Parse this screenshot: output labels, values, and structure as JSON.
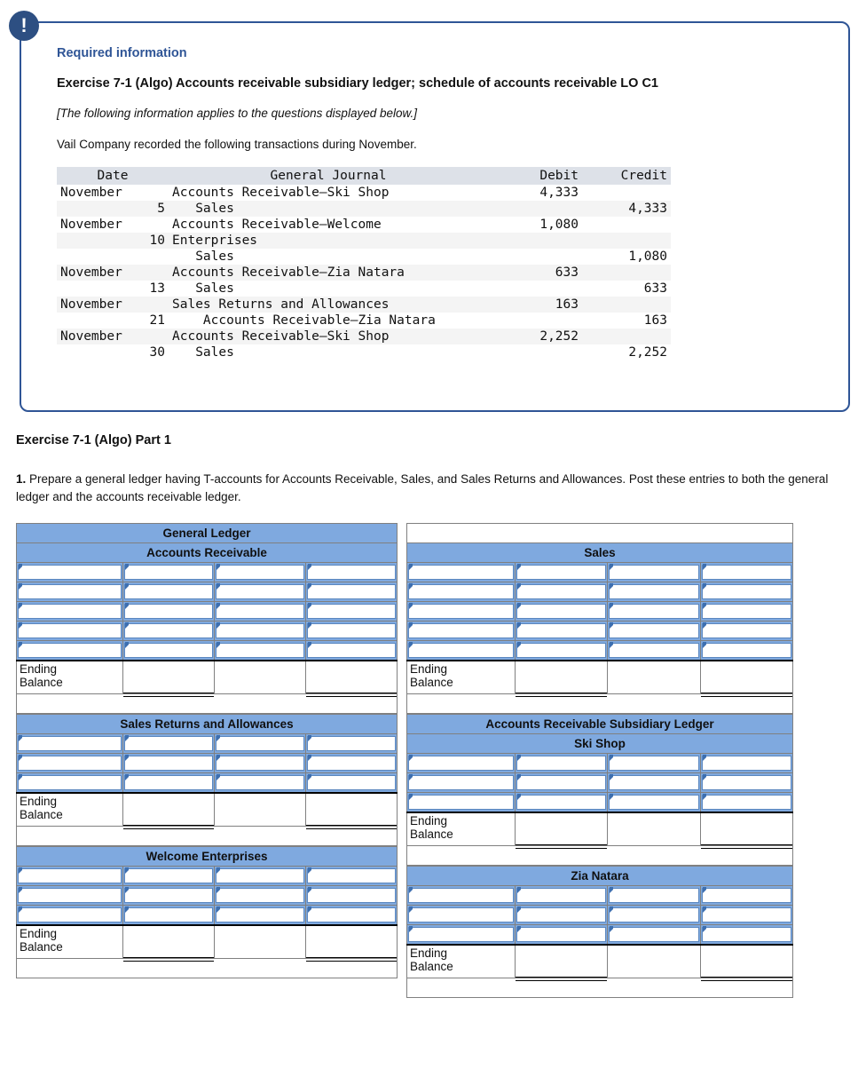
{
  "alert": {
    "icon": "exclamation-icon",
    "required_label": "Required information",
    "exercise_title": "Exercise 7-1 (Algo) Accounts receivable subsidiary ledger; schedule of accounts receivable LO C1",
    "note": "[The following information applies to the questions displayed below.]",
    "intro": "Vail Company recorded the following transactions during November."
  },
  "journal": {
    "headers": {
      "date": "Date",
      "account": "General Journal",
      "debit": "Debit",
      "credit": "Credit"
    },
    "rows": [
      {
        "month": "November",
        "day": "",
        "account": "Accounts Receivable—Ski Shop",
        "debit": "4,333",
        "credit": ""
      },
      {
        "month": "",
        "day": "5",
        "account": "   Sales",
        "debit": "",
        "credit": "4,333"
      },
      {
        "month": "November",
        "day": "",
        "account": "Accounts Receivable—Welcome",
        "debit": "1,080",
        "credit": ""
      },
      {
        "month": "",
        "day": "10",
        "account": "Enterprises",
        "debit": "",
        "credit": ""
      },
      {
        "month": "",
        "day": "",
        "account": "   Sales",
        "debit": "",
        "credit": "1,080"
      },
      {
        "month": "November",
        "day": "",
        "account": "Accounts Receivable—Zia Natara",
        "debit": "633",
        "credit": ""
      },
      {
        "month": "",
        "day": "13",
        "account": "   Sales",
        "debit": "",
        "credit": "633"
      },
      {
        "month": "November",
        "day": "",
        "account": "Sales Returns and Allowances",
        "debit": "163",
        "credit": ""
      },
      {
        "month": "",
        "day": "21",
        "account": "    Accounts Receivable—Zia Natara",
        "debit": "",
        "credit": "163"
      },
      {
        "month": "November",
        "day": "",
        "account": "Accounts Receivable—Ski Shop",
        "debit": "2,252",
        "credit": ""
      },
      {
        "month": "",
        "day": "30",
        "account": "   Sales",
        "debit": "",
        "credit": "2,252"
      }
    ]
  },
  "part": {
    "heading": "Exercise 7-1 (Algo) Part 1",
    "question_number": "1.",
    "question_text": " Prepare a general ledger having T-accounts for Accounts Receivable, Sales, and Sales Returns and Allowances. Post these entries to both the general ledger and the accounts receivable ledger."
  },
  "ledgers": {
    "general_ledger_label": "General Ledger",
    "subsidiary_ledger_label": "Accounts Receivable Subsidiary Ledger",
    "ending_balance_label": "Ending\nBalance",
    "ending_balance_line1": "Ending",
    "ending_balance_line2": "Balance",
    "left": [
      {
        "name": "Accounts Receivable",
        "input_rows": 5
      },
      {
        "name": "Sales Returns and Allowances",
        "input_rows": 3
      },
      {
        "name": "Welcome Enterprises",
        "input_rows": 3
      }
    ],
    "right": [
      {
        "name": "Sales",
        "input_rows": 5
      },
      {
        "name": "Ski Shop",
        "input_rows": 3
      },
      {
        "name": "Zia Natara",
        "input_rows": 3
      }
    ]
  },
  "colors": {
    "accent_blue": "#2f5596",
    "header_blue": "#7fa9df",
    "icon_navy": "#2d4f82",
    "journal_header_gray": "#dde1e8",
    "journal_stripe": "#f4f4f4"
  }
}
